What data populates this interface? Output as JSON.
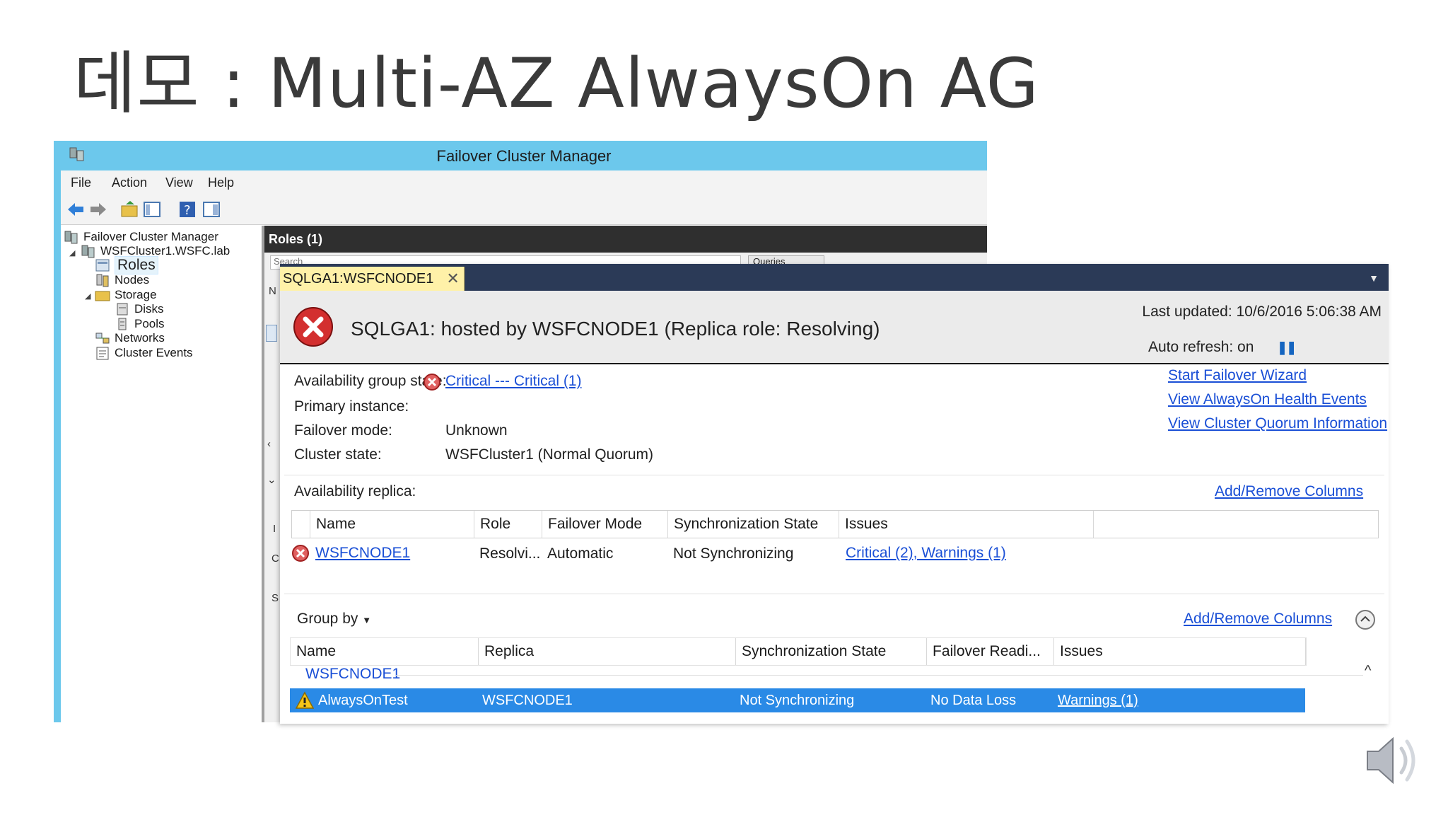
{
  "slide": {
    "title": "데모 : Multi-AZ AlwaysOn AG"
  },
  "window": {
    "title": "Failover Cluster Manager"
  },
  "menu": [
    "File",
    "Action",
    "View",
    "Help"
  ],
  "tree": {
    "root": "Failover Cluster Manager",
    "cluster": "WSFCluster1.WSFC.lab",
    "items": [
      "Roles",
      "Nodes",
      "Storage",
      "Disks",
      "Pools",
      "Networks",
      "Cluster Events"
    ]
  },
  "roles": {
    "header": "Roles (1)",
    "search_placeholder": "Search",
    "queries_label": "Queries",
    "strip_letters": [
      "N",
      "I",
      "C",
      "S"
    ]
  },
  "dashboard": {
    "tab_label": "SQLGA1:WSFCNODE1",
    "heading": "SQLGA1: hosted by WSFCNODE1 (Replica role: Resolving)",
    "last_updated": "Last updated: 10/6/2016 5:06:38 AM",
    "auto_refresh": "Auto refresh: on",
    "ag_state_label": "Availability group state:",
    "ag_state_value": "Critical --- Critical (1)",
    "primary_instance_label": "Primary instance:",
    "primary_instance_value": "",
    "failover_mode_label": "Failover mode:",
    "failover_mode_value": "Unknown",
    "cluster_state_label": "Cluster state:",
    "cluster_state_value": "WSFCluster1 (Normal Quorum)",
    "links": {
      "start_wizard": "Start Failover Wizard",
      "health_events": "View AlwaysOn Health Events",
      "quorum_info": "View Cluster Quorum Information"
    },
    "replica_section_label": "Availability replica:",
    "add_remove_columns": "Add/Remove Columns",
    "replica_columns": [
      "Name",
      "Role",
      "Failover Mode",
      "Synchronization State",
      "Issues"
    ],
    "replica_rows": [
      {
        "name": "WSFCNODE1",
        "role": "Resolvi...",
        "failover_mode": "Automatic",
        "sync_state": "Not Synchronizing",
        "issues": "Critical (2), Warnings (1)"
      }
    ],
    "group_by": "Group by",
    "db_columns": [
      "Name",
      "Replica",
      "Synchronization State",
      "Failover Readi...",
      "Issues"
    ],
    "db_group": "WSFCNODE1",
    "db_rows": [
      {
        "name": "AlwaysOnTest",
        "replica": "WSFCNODE1",
        "sync_state": "Not Synchronizing",
        "failover_readiness": "No Data Loss",
        "issues": "Warnings (1)"
      }
    ]
  },
  "icons": {
    "error": "error-x-icon",
    "warning": "warning-triangle-icon",
    "speaker": "speaker-icon",
    "pause": "pause-icon"
  },
  "colors": {
    "titlebar": "#6cc8ec",
    "tabbar": "#2b3a57",
    "tab": "#fff1a8",
    "link": "#1a4fd6",
    "selection": "#2a8ae6",
    "error": "#d32f2f"
  }
}
